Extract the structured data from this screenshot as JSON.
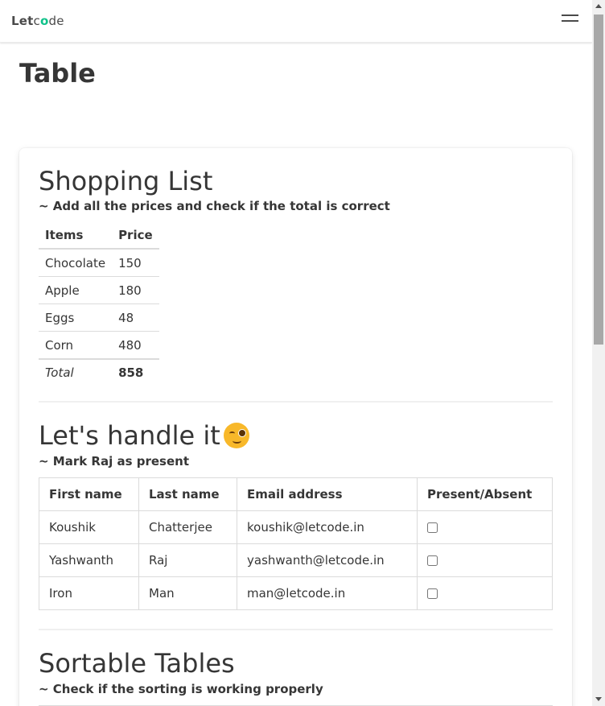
{
  "navbar": {
    "logo_let": "Let",
    "logo_c": "c",
    "logo_o": "o",
    "logo_de": "de",
    "menu_icon": "hamburger-menu-icon"
  },
  "page": {
    "title": "Table"
  },
  "shopping": {
    "title": "Shopping List",
    "subtitle": "~ Add all the prices and check if the total is correct",
    "headers": [
      "Items",
      "Price"
    ],
    "rows": [
      {
        "item": "Chocolate",
        "price": "150"
      },
      {
        "item": "Apple",
        "price": "180"
      },
      {
        "item": "Eggs",
        "price": "48"
      },
      {
        "item": "Corn",
        "price": "480"
      }
    ],
    "total_label": "Total",
    "total_value": "858"
  },
  "attendance": {
    "title": "Let's handle it",
    "emoji": "winking-face-emoji",
    "subtitle": "~ Mark Raj as present",
    "headers": [
      "First name",
      "Last name",
      "Email address",
      "Present/Absent"
    ],
    "rows": [
      {
        "first": "Koushik",
        "last": "Chatterjee",
        "email": "koushik@letcode.in",
        "present": false
      },
      {
        "first": "Yashwanth",
        "last": "Raj",
        "email": "yashwanth@letcode.in",
        "present": false
      },
      {
        "first": "Iron",
        "last": "Man",
        "email": "man@letcode.in",
        "present": false
      }
    ]
  },
  "sortable": {
    "title": "Sortable Tables",
    "subtitle": "~ Check if the sorting is working properly"
  },
  "colors": {
    "accent": "#10c28a",
    "text": "#363636",
    "border": "#dbdbdb"
  }
}
